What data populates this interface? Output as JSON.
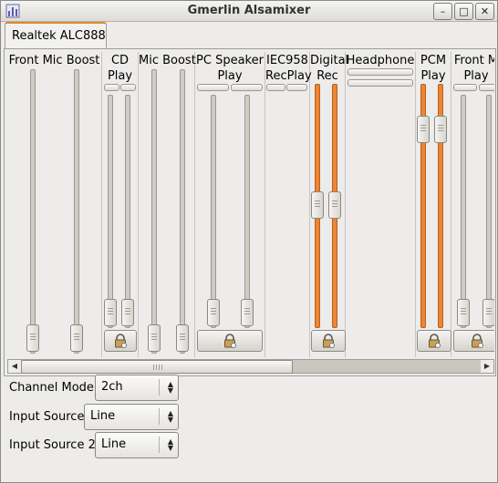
{
  "window": {
    "title": "Gmerlin Alsamixer"
  },
  "titlebar_buttons": {
    "minimize": "–",
    "maximize": "□",
    "close": "✕"
  },
  "tab": {
    "label": "Realtek ALC888"
  },
  "channels": [
    {
      "name": "Front Mic Boost",
      "level": 0.0
    },
    {
      "name": "CD\nPlay",
      "level": 0.0
    },
    {
      "name": "Mic Boost",
      "level": 0.0
    },
    {
      "name": "PC Speaker\nPlay",
      "level": 0.0
    },
    {
      "name": "IEC958\nRecPlay"
    },
    {
      "name": "Digital\nRec",
      "level": 0.5
    },
    {
      "name": "Headphone"
    },
    {
      "name": "PCM\nPlay",
      "level": 0.85
    },
    {
      "name": "Front M\nPlay",
      "level": 0.0
    }
  ],
  "scroll_arrows": {
    "left": "◀",
    "right": "▶"
  },
  "options": [
    {
      "label": "Channel Mode",
      "value": "2ch"
    },
    {
      "label": "Input Source",
      "value": "Line"
    },
    {
      "label": "Input Source 2",
      "value": "Line"
    }
  ],
  "icons": {
    "lock": "lock-icon",
    "app": "mixer-app-icon"
  },
  "colors": {
    "accent": "#ee8532",
    "tab_highlight": "#e08a2c"
  }
}
